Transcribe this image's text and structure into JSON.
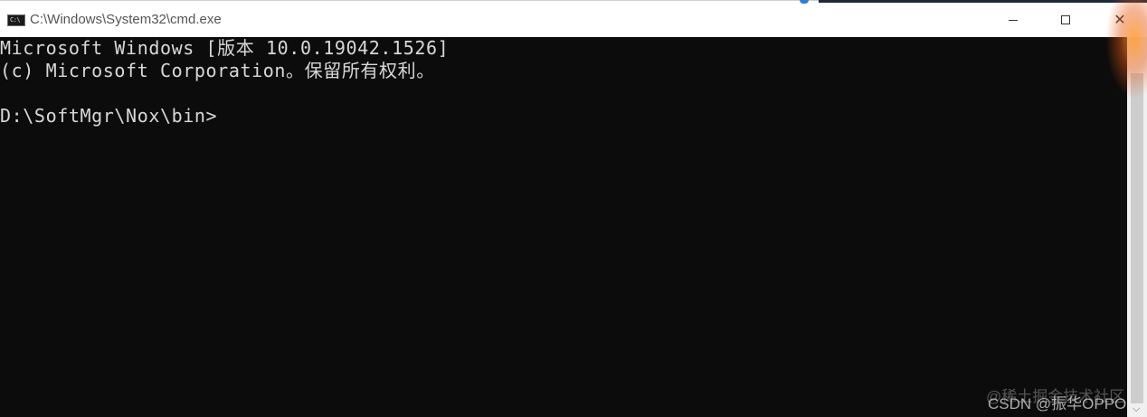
{
  "window": {
    "title": "C:\\Windows\\System32\\cmd.exe",
    "icon_label": "C:\\"
  },
  "controls": {
    "minimize_icon": "minimize-icon",
    "maximize_icon": "maximize-icon",
    "close_icon": "close-icon",
    "close_glyph": "✕"
  },
  "console": {
    "lines": [
      "Microsoft Windows [版本 10.0.19042.1526]",
      "(c) Microsoft Corporation。保留所有权利。",
      "D:\\SoftMgr\\Nox\\bin>"
    ]
  },
  "scrollbar": {
    "down_arrow": "⌵"
  },
  "watermark": {
    "line1": "@稀土掘金技术社区",
    "line2": "CSDN @振华OPPO"
  },
  "colors": {
    "console_bg": "#0c0c0c",
    "console_text": "#d8d8d8",
    "titlebar_bg": "#ffffff"
  }
}
